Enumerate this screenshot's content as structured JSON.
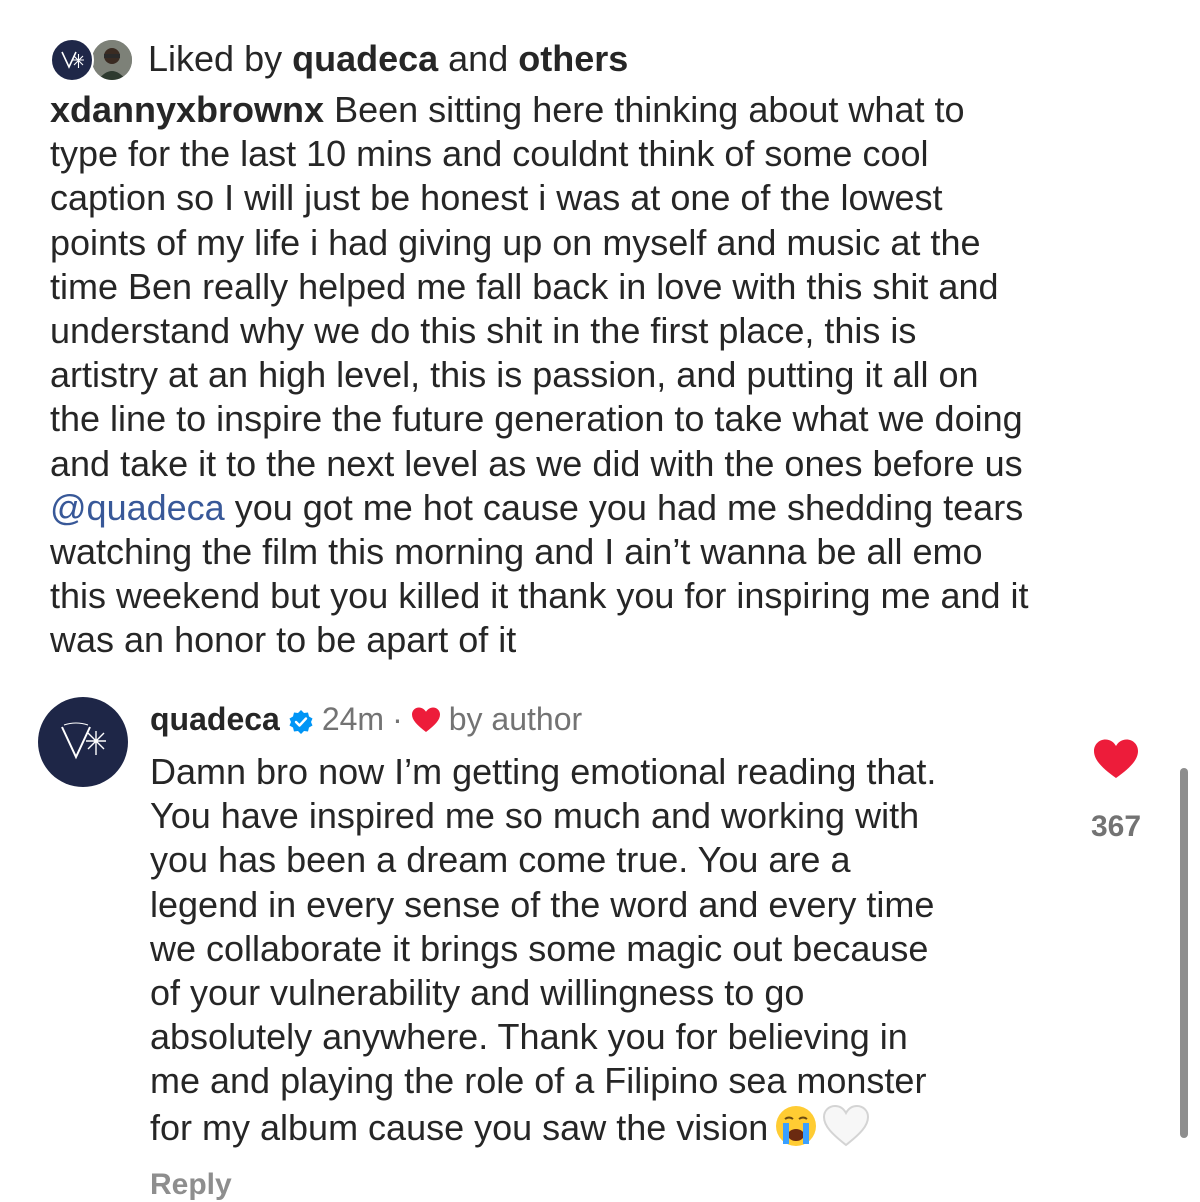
{
  "liked": {
    "prefix": "Liked by ",
    "user": "quadeca",
    "middle": " and ",
    "others": "others"
  },
  "caption": {
    "username": "xdannyxbrownx",
    "text_part1": " Been sitting here thinking about what to\ntype for the last 10 mins and couldnt think of some cool\ncaption so I will just be honest i was at one of the lowest\npoints of my life i had giving up on myself and music at the\ntime Ben really helped me fall back in love with this shit and\nunderstand why we do this shit in the first place, this is\nartistry at an high level, this is passion, and putting it all on\nthe line to inspire the future generation to take what we doing\nand take it to the next level as we did with the ones before us\n",
    "mention": "@quadeca",
    "text_part2": " you got me hot cause you had me shedding tears\nwatching the film this morning and I ain’t wanna be all emo\nthis weekend but you killed it thank you for inspiring me and it\nwas an honor to be apart of it"
  },
  "comment": {
    "username": "quadeca",
    "time": "24m",
    "separator": "·",
    "liked_by": "by author",
    "text": "Damn bro now I’m getting emotional reading that.\nYou have inspired me so much and working with\nyou has been a dream come true. You are a\nlegend in every sense of the word and every time\nwe collaborate it brings some magic out because\nof your vulnerability and willingness to go\nabsolutely anywhere. Thank you for believing in\nme and playing the role of a Filipino sea monster\nfor my album cause you saw the vision",
    "like_count": "367",
    "reply_label": "Reply"
  },
  "colors": {
    "mention": "#385898",
    "heart": "#ed1c3a",
    "verified": "#0095f6",
    "avatar_bg": "#1e2647"
  },
  "icons": [
    "quadeca-logo-icon",
    "user-photo-icon",
    "verified-icon",
    "heart-icon",
    "crying-face-icon",
    "white-heart-icon"
  ]
}
